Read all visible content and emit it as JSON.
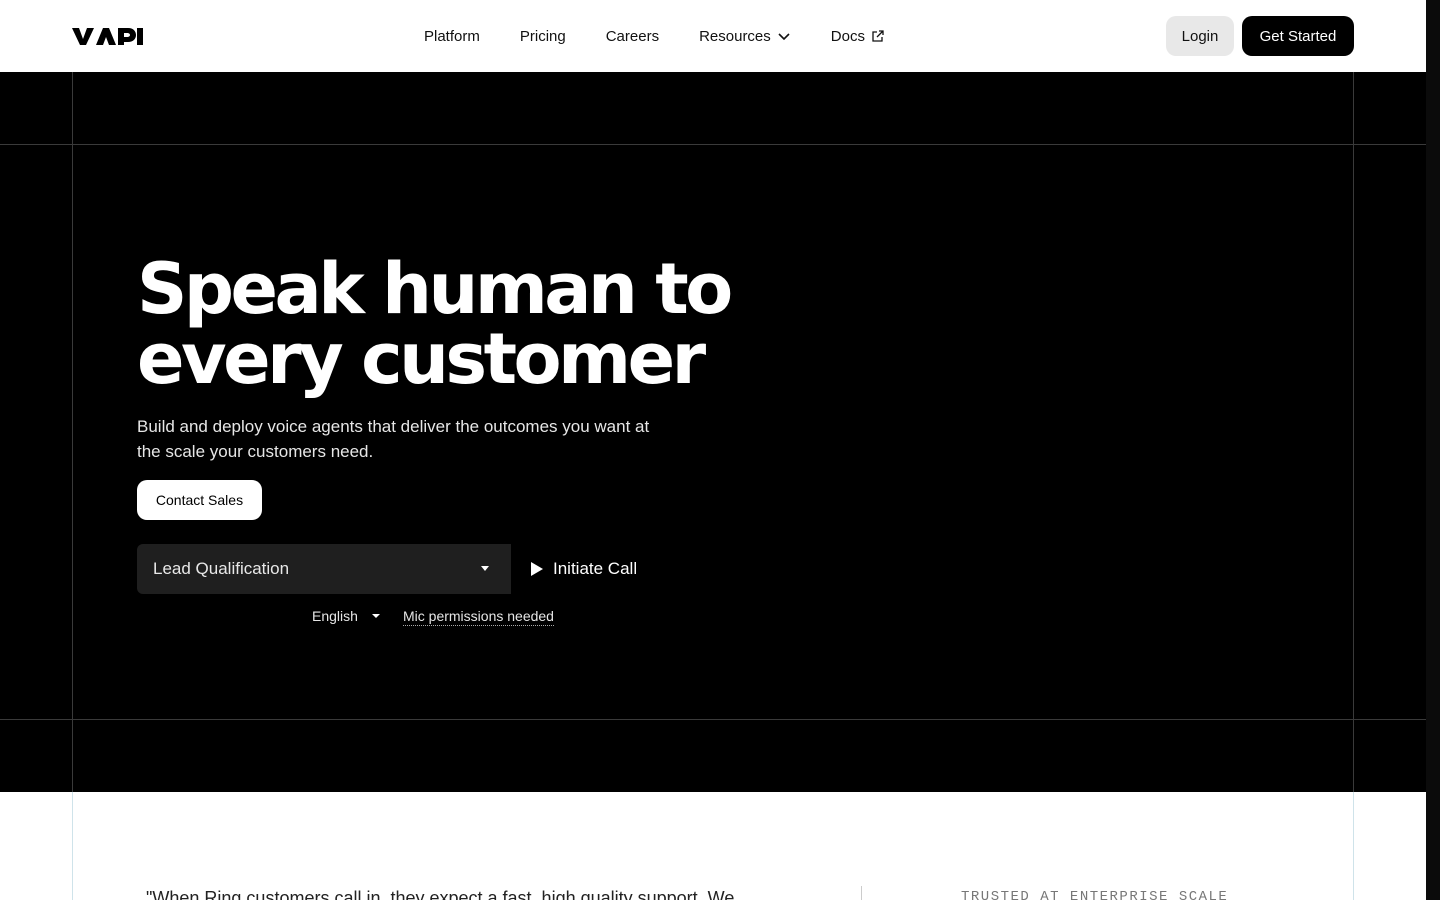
{
  "brand": {
    "logo_text": "VAPI"
  },
  "nav": {
    "items": [
      {
        "label": "Platform"
      },
      {
        "label": "Pricing"
      },
      {
        "label": "Careers"
      },
      {
        "label": "Resources"
      },
      {
        "label": "Docs"
      }
    ]
  },
  "header": {
    "login_label": "Login",
    "get_started_label": "Get Started"
  },
  "hero": {
    "headline": "Speak human to every customer",
    "subtext": "Build and deploy voice agents that deliver the outcomes you want at the scale your customers need.",
    "contact_label": "Contact Sales",
    "use_case_selected": "Lead Qualification",
    "initiate_label": "Initiate Call",
    "language_selected": "English",
    "mic_notice": "Mic permissions needed"
  },
  "testimonial": {
    "quote_start": "\"When Ring customers call in, they expect a fast, high quality support. We",
    "trusted_label": "TRUSTED AT ENTERPRISE SCALE"
  },
  "colors": {
    "hero_bg": "#000000",
    "accent": "#000000",
    "select_bg": "#1f1f1f"
  }
}
